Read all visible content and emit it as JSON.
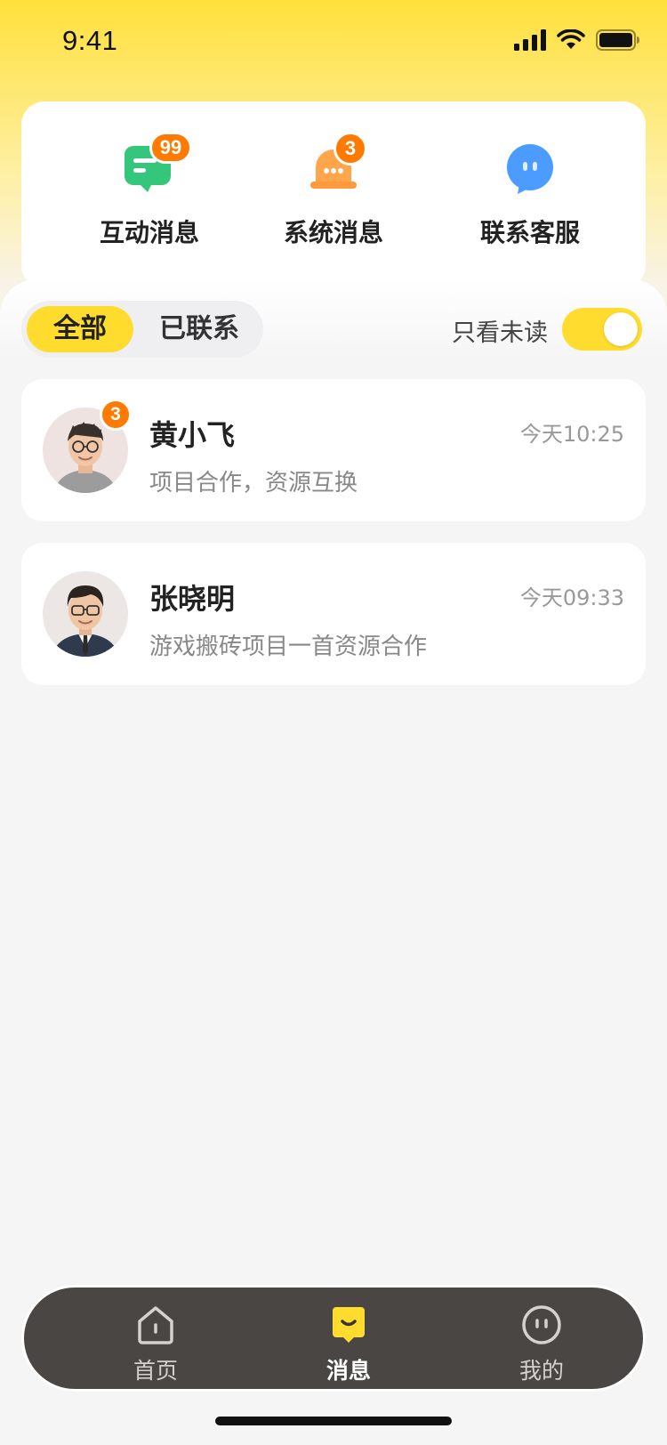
{
  "status_bar": {
    "time": "9:41"
  },
  "top_actions": [
    {
      "label": "互动消息",
      "icon": "chat-bubble-icon",
      "badge": "99",
      "color": "#34C77B"
    },
    {
      "label": "系统消息",
      "icon": "bell-icon",
      "badge": "3",
      "color": "#FF9A3C"
    },
    {
      "label": "联系客服",
      "icon": "service-bubble-icon",
      "badge": "",
      "color": "#4C9BFF"
    }
  ],
  "filter": {
    "tabs": [
      {
        "label": "全部",
        "active": true
      },
      {
        "label": "已联系",
        "active": false
      }
    ],
    "unread_only_label": "只看未读",
    "unread_only_on": true
  },
  "conversations": [
    {
      "name": "黄小飞",
      "time": "今天10:25",
      "preview": "项目合作，资源互换",
      "unread": "3"
    },
    {
      "name": "张晓明",
      "time": "今天09:33",
      "preview": "游戏搬砖项目一首资源合作",
      "unread": ""
    }
  ],
  "tab_bar": [
    {
      "label": "首页",
      "icon": "home-icon",
      "active": false
    },
    {
      "label": "消息",
      "icon": "message-icon",
      "active": true
    },
    {
      "label": "我的",
      "icon": "profile-icon",
      "active": false
    }
  ],
  "colors": {
    "accent": "#FFDC2E",
    "badge": "#FF7A00",
    "tab_bar_bg": "#4A4643"
  }
}
